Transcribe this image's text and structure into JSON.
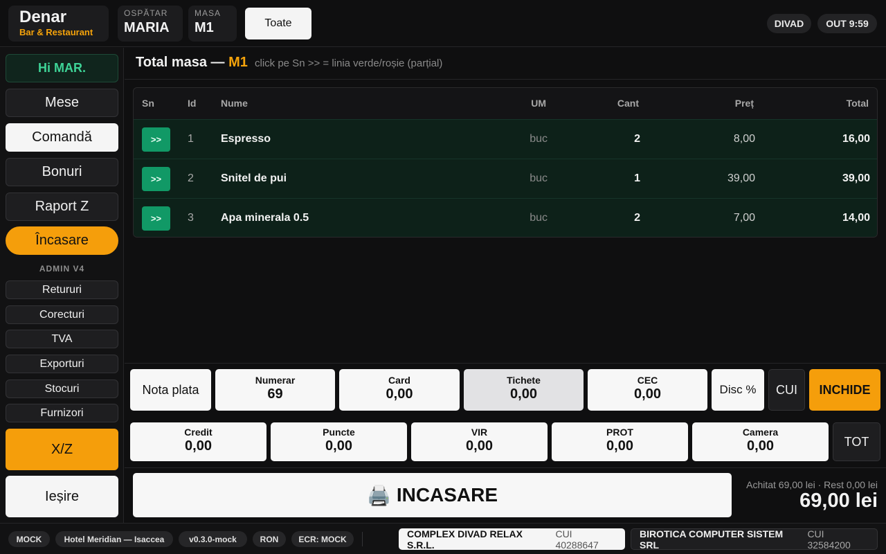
{
  "header": {
    "brand_name": "Denar",
    "brand_sub": "Bar & Restaurant",
    "waiter_label": "OSPĂTAR",
    "waiter_value": "MARIA",
    "table_label": "MASA",
    "table_value": "M1",
    "toate_label": "Toate",
    "divad_label": "DIVAD",
    "out_label": "OUT 9:59"
  },
  "sidebar": {
    "greeting": "Hi MAR.",
    "items": [
      "Mese",
      "Comandă",
      "Bonuri",
      "Raport Z",
      "Încasare"
    ],
    "section_label": "ADMIN V4",
    "admin_items": [
      "Retururi",
      "Corecturi",
      "TVA",
      "Exporturi",
      "Stocuri",
      "Furnizori"
    ],
    "xz_label": "X/Z",
    "exit_label": "Ieșire"
  },
  "main": {
    "title_prefix": "Total masa —",
    "title_table": "M1",
    "hint": "click pe Sn >> = linia verde/roșie (parțial)"
  },
  "table": {
    "columns": [
      "Sn",
      "Id",
      "Nume",
      "UM",
      "Cant",
      "Preț",
      "Total"
    ],
    "rows": [
      {
        "sn": ">>",
        "id": "1",
        "name": "Espresso",
        "um": "buc",
        "qty": "2",
        "price": "8,00",
        "total": "16,00"
      },
      {
        "sn": ">>",
        "id": "2",
        "name": "Snitel de pui",
        "um": "buc",
        "qty": "1",
        "price": "39,00",
        "total": "39,00"
      },
      {
        "sn": ">>",
        "id": "3",
        "name": "Apa minerala 0.5",
        "um": "buc",
        "qty": "2",
        "price": "7,00",
        "total": "14,00"
      }
    ]
  },
  "payments": {
    "nota_plata": "Nota plata",
    "row1": [
      {
        "label": "Numerar",
        "value": "69"
      },
      {
        "label": "Card",
        "value": "0,00"
      },
      {
        "label": "Tichete",
        "value": "0,00"
      },
      {
        "label": "CEC",
        "value": "0,00"
      }
    ],
    "disc": "Disc %",
    "cui": "CUI",
    "inchide": "INCHIDE",
    "row2": [
      {
        "label": "Credit",
        "value": "0,00"
      },
      {
        "label": "Puncte",
        "value": "0,00"
      },
      {
        "label": "VIR",
        "value": "0,00"
      },
      {
        "label": "PROT",
        "value": "0,00"
      },
      {
        "label": "Camera",
        "value": "0,00"
      }
    ],
    "tot": "TOT",
    "incasare_icon": "🖨️",
    "incasare_label": "INCASARE",
    "summary": "Achitat 69,00 lei · Rest 0,00 lei",
    "total": "69,00 lei"
  },
  "status": {
    "chips": [
      "MOCK",
      "Hotel Meridian — Isaccea",
      "v0.3.0-mock",
      "RON",
      "ECR: MOCK"
    ],
    "company1_name": "COMPLEX DIVAD RELAX S.R.L.",
    "company1_cui": "CUI 40288647",
    "company2_name": "BIROTICA COMPUTER SISTEM SRL",
    "company2_cui": "CUI 32584200"
  },
  "colors": {
    "accent": "#f5a30b",
    "green": "#119966",
    "background": "#0f0f10"
  }
}
